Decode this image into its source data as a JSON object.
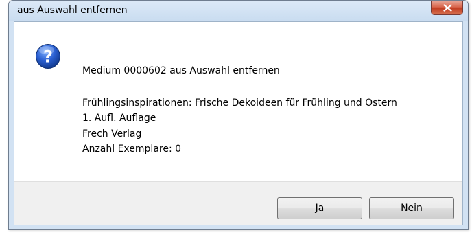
{
  "window": {
    "title": "aus Auswahl entfernen"
  },
  "icons": {
    "question": "question-mark-icon",
    "close": "close-icon"
  },
  "message": {
    "line1": "Medium 0000602  aus Auswahl entfernen",
    "title": "Frühlingsinspirationen: Frische Dekoideen für Frühling und Ostern",
    "edition": "1. Aufl. Auflage",
    "publisher": "Frech Verlag",
    "copies": "Anzahl Exemplare:   0"
  },
  "buttons": {
    "yes_label": "Ja",
    "no_label": "Nein"
  },
  "colors": {
    "frame": "#d2e2f3",
    "close_button": "#c94b2d",
    "footer": "#f0f0f0"
  }
}
